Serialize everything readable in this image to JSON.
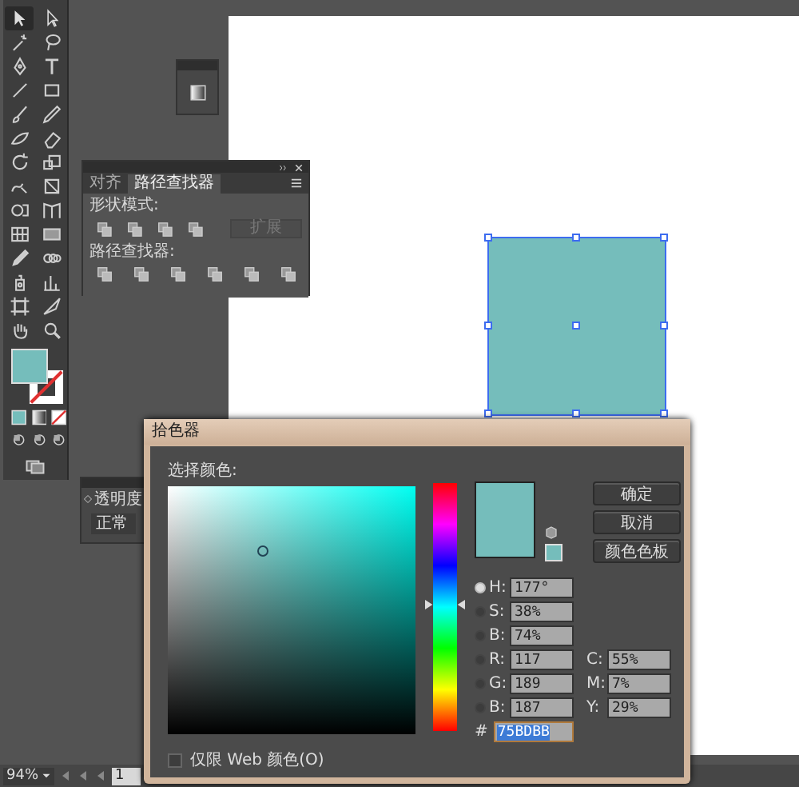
{
  "pathfinder_panel": {
    "tabs": [
      {
        "label": "对齐",
        "selected": false
      },
      {
        "label": "路径查找器",
        "selected": true
      }
    ],
    "shape_modes_label": "形状模式:",
    "expand_button": {
      "label": "扩展",
      "disabled": true
    },
    "pathfinders_label": "路径查找器:"
  },
  "transparency_panel": {
    "tab": "透明度",
    "blend_mode": "正常"
  },
  "color_picker": {
    "title": "拾色器",
    "select_label": "选择颜色:",
    "fields": [
      {
        "label": "H:",
        "value": "177°",
        "selected": true
      },
      {
        "label": "S:",
        "value": "38%",
        "selected": false
      },
      {
        "label": "B:",
        "value": "74%",
        "selected": false
      },
      {
        "label": "R:",
        "value": "117",
        "selected": false
      },
      {
        "label": "G:",
        "value": "189",
        "selected": false
      },
      {
        "label": "B:",
        "value": "187",
        "selected": false
      }
    ],
    "cmyk": [
      {
        "label": "C:",
        "value": "55%"
      },
      {
        "label": "M:",
        "value": "7%"
      },
      {
        "label": "Y:",
        "value": "29%"
      }
    ],
    "hue_slider": {
      "level": 0.508
    },
    "hex_label": "#",
    "hex": "75BDBB",
    "hex_selected": true,
    "buttons": [
      "确定",
      "取消",
      "颜色色板"
    ],
    "web_only": {
      "label": "仅限 Web 颜色(O)",
      "checked": false
    }
  },
  "status_bar": {
    "zoom": "94%",
    "artboard": "1"
  }
}
